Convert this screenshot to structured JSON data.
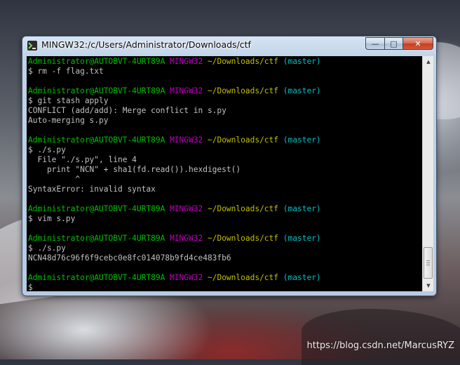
{
  "window": {
    "title": "MINGW32:/c/Users/Administrator/Downloads/ctf",
    "app_icon": "mingw-git-icon",
    "buttons": {
      "minimize": "—",
      "maximize": "□",
      "close": "✕"
    }
  },
  "colors": {
    "terminal_bg": "#000000",
    "text": "#c0c0c0",
    "user_host": "#00c000",
    "system": "#c000c0",
    "path": "#c0c000",
    "branch": "#00c0c0"
  },
  "terminal": {
    "prompt": {
      "user_host": "Administrator@AUTOBVT-4URT89A",
      "system": "MINGW32",
      "path": "~/Downloads/ctf",
      "branch": "(master)"
    },
    "lines": [
      {
        "type": "prompt"
      },
      {
        "type": "text",
        "text": "$ rm -f flag.txt"
      },
      {
        "type": "text",
        "text": ""
      },
      {
        "type": "prompt"
      },
      {
        "type": "text",
        "text": "$ git stash apply"
      },
      {
        "type": "text",
        "text": "CONFLICT (add/add): Merge conflict in s.py"
      },
      {
        "type": "text",
        "text": "Auto-merging s.py"
      },
      {
        "type": "text",
        "text": ""
      },
      {
        "type": "prompt"
      },
      {
        "type": "text",
        "text": "$ ./s.py"
      },
      {
        "type": "text",
        "text": "  File \"./s.py\", line 4"
      },
      {
        "type": "text",
        "text": "    print \"NCN\" + sha1(fd.read()).hexdigest()"
      },
      {
        "type": "text",
        "text": "          ^"
      },
      {
        "type": "text",
        "text": "SyntaxError: invalid syntax"
      },
      {
        "type": "text",
        "text": ""
      },
      {
        "type": "prompt"
      },
      {
        "type": "text",
        "text": "$ vim s.py"
      },
      {
        "type": "text",
        "text": ""
      },
      {
        "type": "prompt"
      },
      {
        "type": "text",
        "text": "$ ./s.py"
      },
      {
        "type": "text",
        "text": "NCN48d76c96f6f9cebc0e8fc014078b9fd4ce483fb6"
      },
      {
        "type": "text",
        "text": ""
      },
      {
        "type": "prompt"
      },
      {
        "type": "text",
        "text": "$"
      }
    ]
  },
  "scrollbar": {
    "up_arrow_icon": "scroll-up-icon",
    "down_arrow_icon": "scroll-down-icon",
    "position": "bottom"
  },
  "watermark": "https://blog.csdn.net/MarcusRYZ"
}
